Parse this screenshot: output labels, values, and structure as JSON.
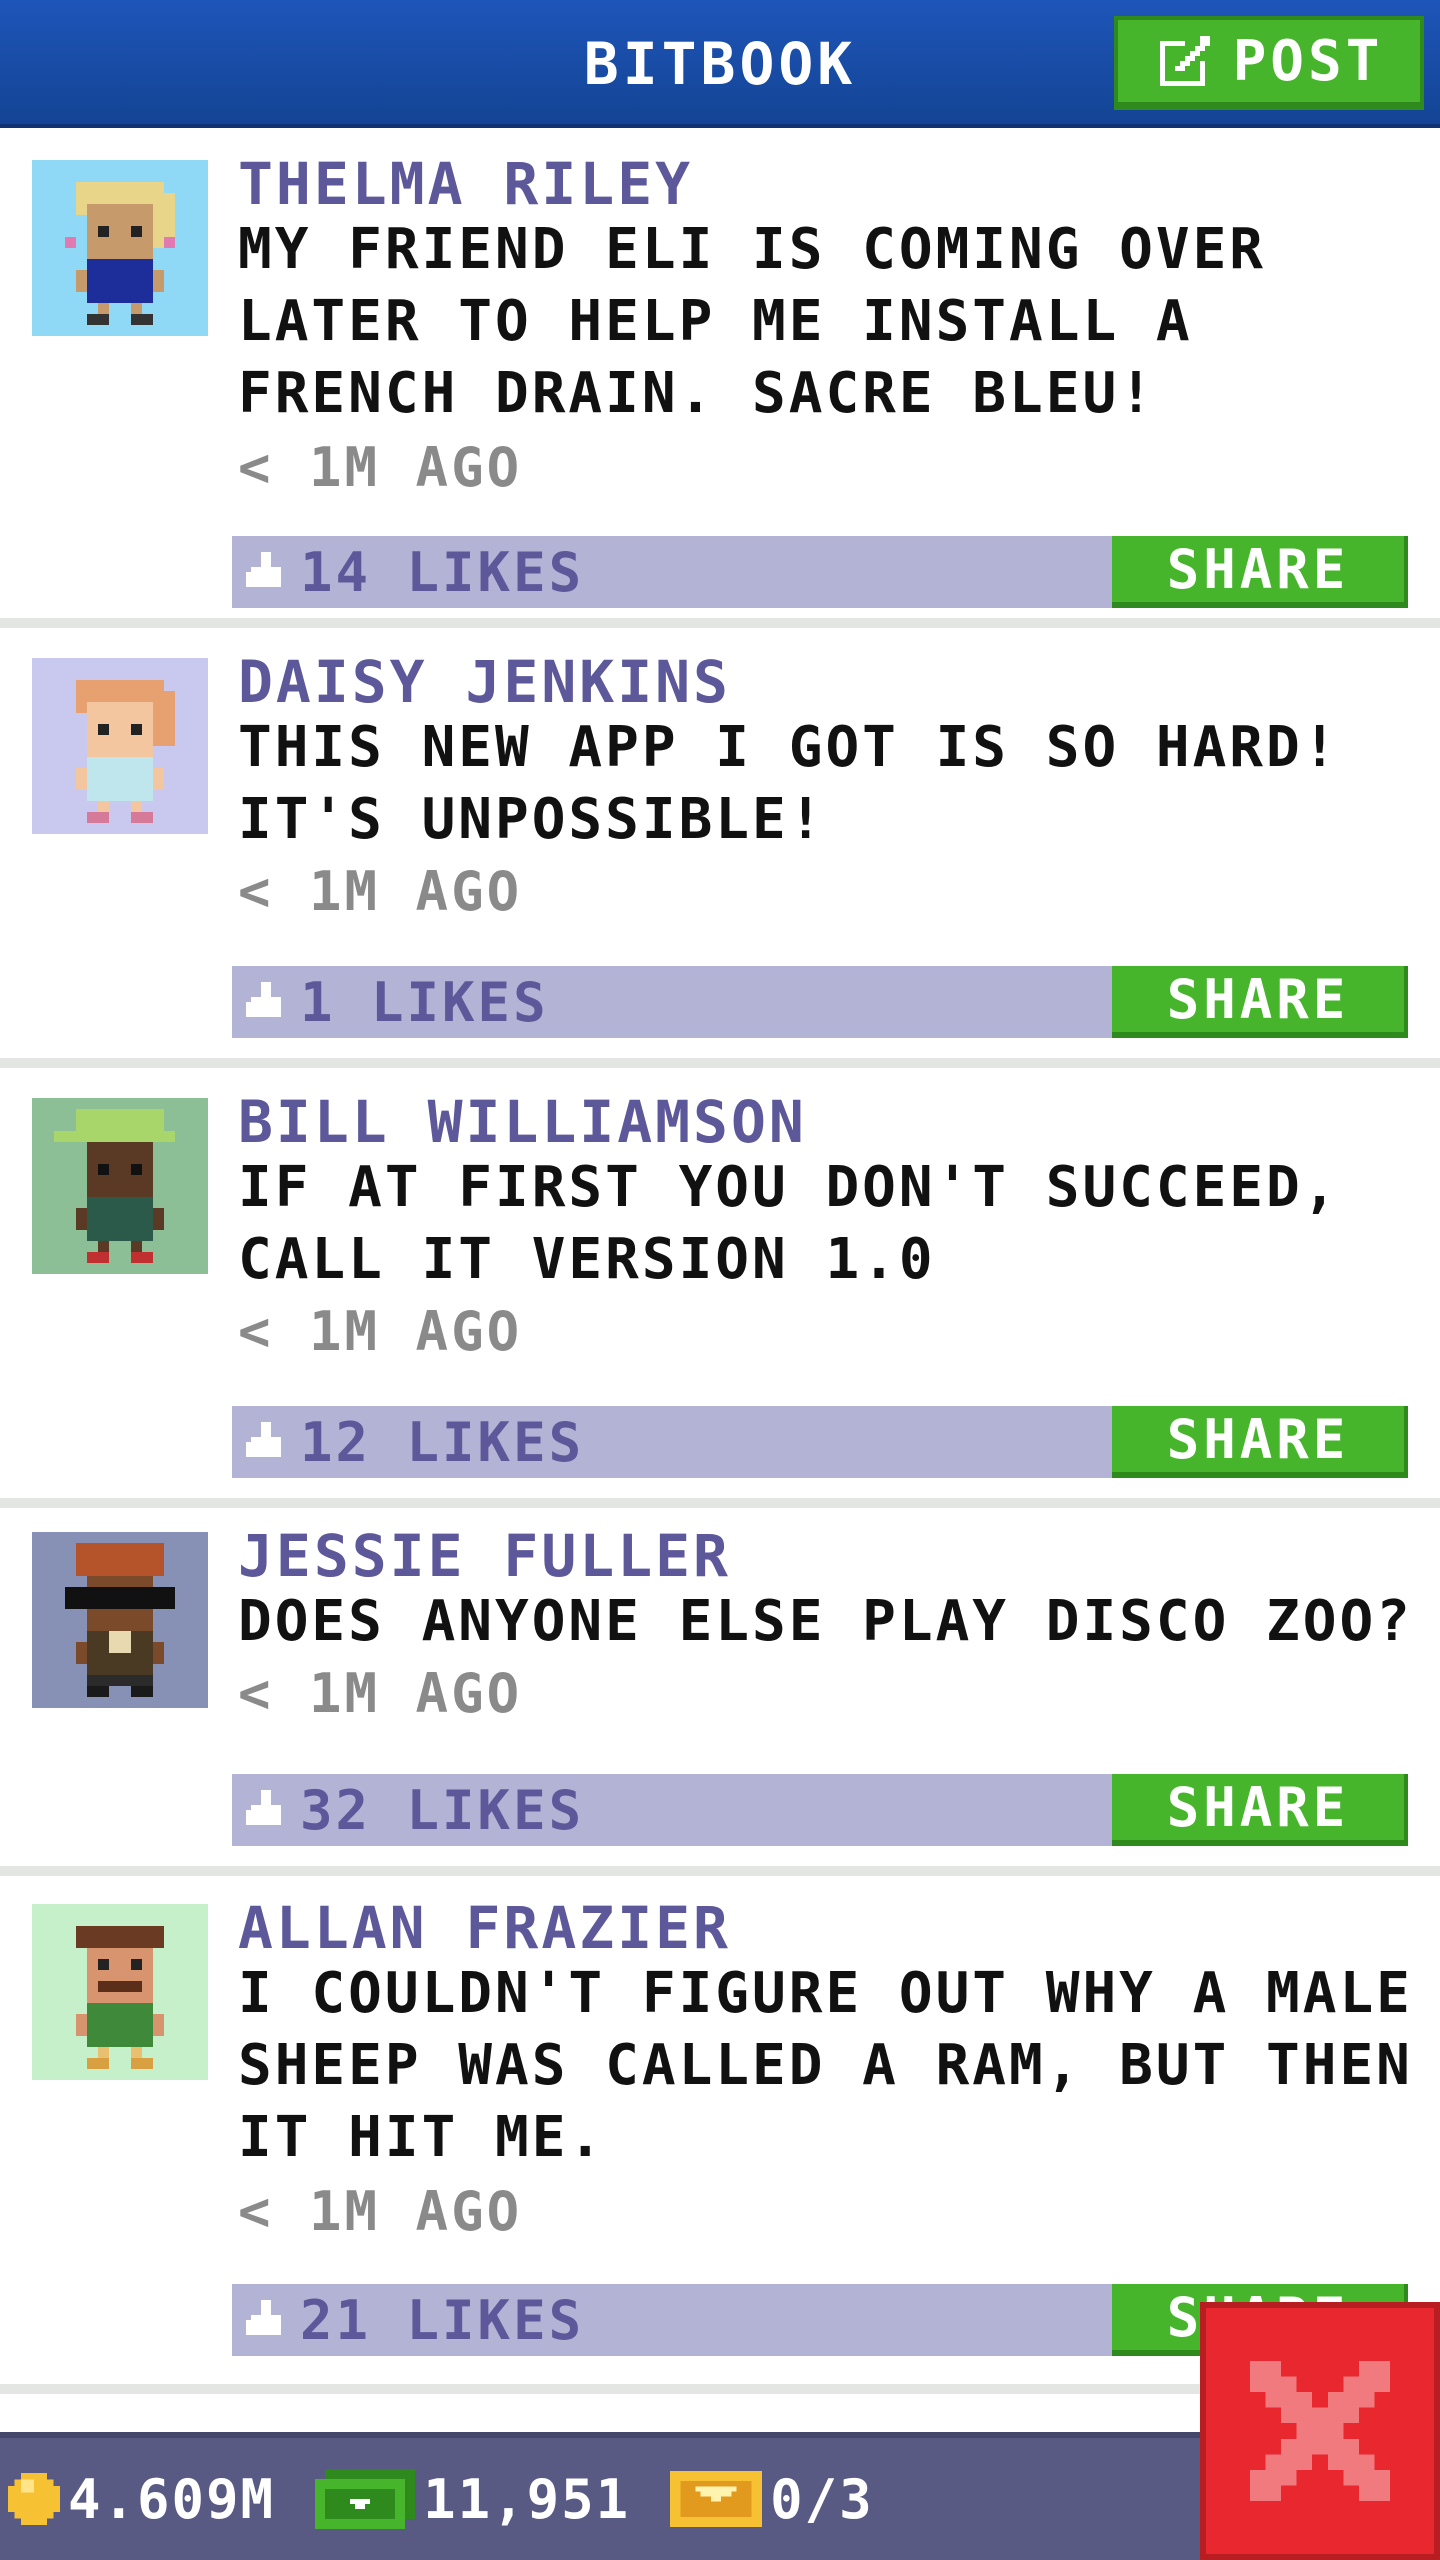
{
  "header": {
    "title": "BITBOOK",
    "post_label": "POST"
  },
  "posts": [
    {
      "author": "THELMA RILEY",
      "content": "MY FRIEND ELI IS COMING OVER LATER TO HELP ME INSTALL A FRENCH DRAIN. SACRE BLEU!",
      "time": "< 1M AGO",
      "likes": "14 LIKES",
      "share_label": "SHARE",
      "avatar_bg": "#8fd8f6"
    },
    {
      "author": "DAISY JENKINS",
      "content": "THIS NEW APP I GOT IS SO HARD! IT'S UNPOSSIBLE!",
      "time": "< 1M AGO",
      "likes": "1 LIKES",
      "share_label": "SHARE",
      "avatar_bg": "#c9c9ef"
    },
    {
      "author": "BILL WILLIAMSON",
      "content": "IF AT FIRST YOU DON'T SUCCEED, CALL IT VERSION 1.0",
      "time": "< 1M AGO",
      "likes": "12 LIKES",
      "share_label": "SHARE",
      "avatar_bg": "#8cbf96"
    },
    {
      "author": "JESSIE FULLER",
      "content": "DOES ANYONE ELSE PLAY DISCO ZOO?",
      "time": "< 1M AGO",
      "likes": "32 LIKES",
      "share_label": "SHARE",
      "avatar_bg": "#8790b5"
    },
    {
      "author": "ALLAN FRAZIER",
      "content": "I COULDN'T FIGURE OUT WHY A MALE SHEEP WAS CALLED A RAM, BUT THEN IT HIT ME.",
      "time": "< 1M AGO",
      "likes": "21 LIKES",
      "share_label": "SHARE",
      "avatar_bg": "#c6f0c9"
    }
  ],
  "footer": {
    "coins": "4.609M",
    "bux": "11,951",
    "tickets": "0/3"
  },
  "colors": {
    "header_blue": "#1e55b9",
    "button_green": "#47b52c",
    "likes_bar": "#b3b3d6",
    "author_purple": "#5d5899",
    "close_red": "#e8272e"
  },
  "icons": [
    "post-edit-icon",
    "thumbs-up-icon",
    "coin-icon",
    "cash-icon",
    "ticket-icon",
    "close-icon"
  ]
}
